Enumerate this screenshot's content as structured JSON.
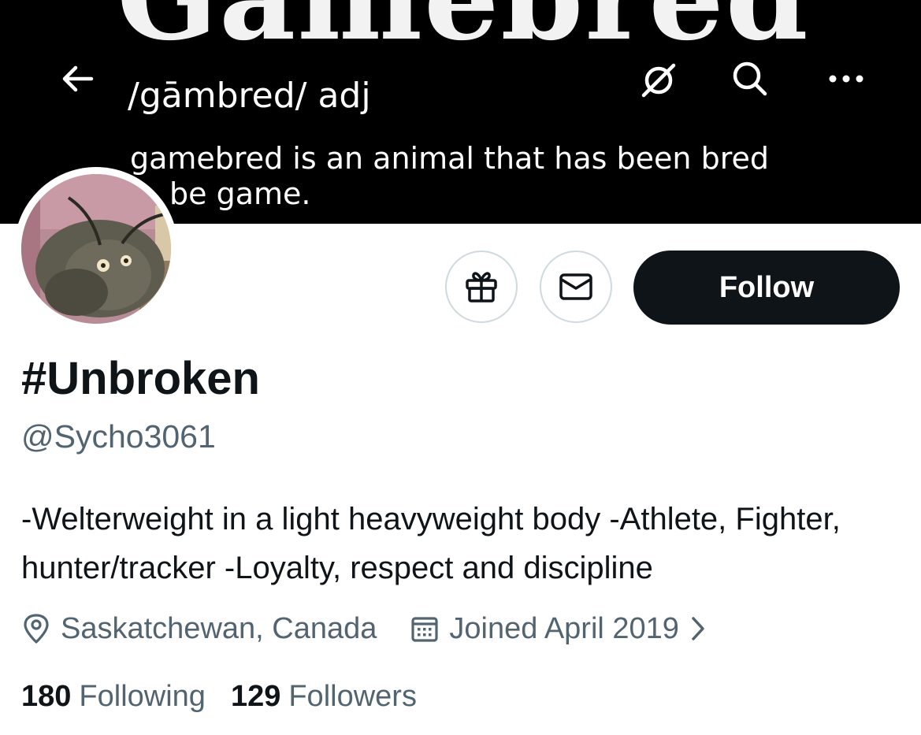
{
  "banner": {
    "gothic_text": "Gamebred",
    "phonetic": "/gāmbred/  adj",
    "definition_line1": "gamebred is an animal that has been bred",
    "definition_line2": "be game."
  },
  "top_bar": {
    "back_icon": "arrow-left-icon",
    "hide_icon": "eye-slash-icon",
    "search_icon": "search-icon",
    "more_icon": "ellipsis-icon"
  },
  "actions": {
    "gift_icon": "gift-icon",
    "message_icon": "envelope-icon",
    "follow_label": "Follow"
  },
  "profile": {
    "display_name": "#Unbroken",
    "handle": "@Sycho3061",
    "bio": "-Welterweight in a light heavyweight body -Athlete, Fighter, hunter/tracker -Loyalty, respect and discipline",
    "location": "Saskatchewan, Canada",
    "joined": "Joined April 2019"
  },
  "stats": {
    "following_count": "180",
    "following_label": "Following",
    "followers_count": "129",
    "followers_label": "Followers"
  },
  "colors": {
    "primary_text": "#0f1419",
    "secondary_text": "#536471",
    "border": "#cfd9de",
    "button_dark": "#0f1419",
    "banner_bg": "#000000"
  }
}
